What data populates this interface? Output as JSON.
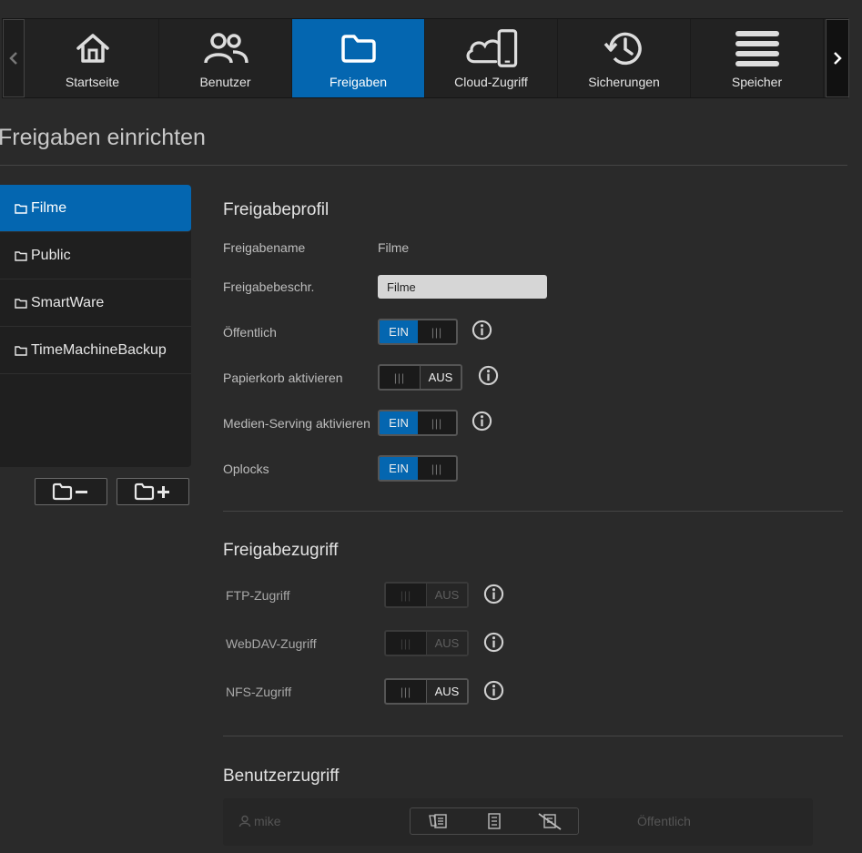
{
  "nav": {
    "items": [
      {
        "label": "Startseite",
        "icon": "home-icon"
      },
      {
        "label": "Benutzer",
        "icon": "users-icon"
      },
      {
        "label": "Freigaben",
        "icon": "folder-icon",
        "active": true
      },
      {
        "label": "Cloud-Zugriff",
        "icon": "cloud-device-icon"
      },
      {
        "label": "Sicherungen",
        "icon": "history-icon"
      },
      {
        "label": "Speicher",
        "icon": "storage-icon"
      }
    ],
    "active_color": "#0466b0"
  },
  "page": {
    "title": "Freigaben einrichten"
  },
  "shares": {
    "items": [
      {
        "label": "Filme",
        "active": true
      },
      {
        "label": "Public"
      },
      {
        "label": "SmartWare"
      },
      {
        "label": "TimeMachineBackup"
      }
    ]
  },
  "profile": {
    "title": "Freigabeprofil",
    "name_label": "Freigabename",
    "name_value": "Filme",
    "desc_label": "Freigabebeschr.",
    "desc_value": "Filme",
    "public_label": "Öffentlich",
    "public_state": "EIN",
    "trash_label": "Papierkorb aktivieren",
    "trash_state": "AUS",
    "media_label": "Medien-Serving aktivieren",
    "media_state": "EIN",
    "oplocks_label": "Oplocks",
    "oplocks_state": "EIN"
  },
  "access": {
    "title": "Freigabezugriff",
    "ftp_label": "FTP-Zugriff",
    "ftp_state": "AUS",
    "webdav_label": "WebDAV-Zugriff",
    "webdav_state": "AUS",
    "nfs_label": "NFS-Zugriff",
    "nfs_state": "AUS"
  },
  "users": {
    "title": "Benutzerzugriff",
    "rows": [
      {
        "name": "mike",
        "status": "Öffentlich"
      }
    ]
  },
  "toggle_grip": "|||"
}
